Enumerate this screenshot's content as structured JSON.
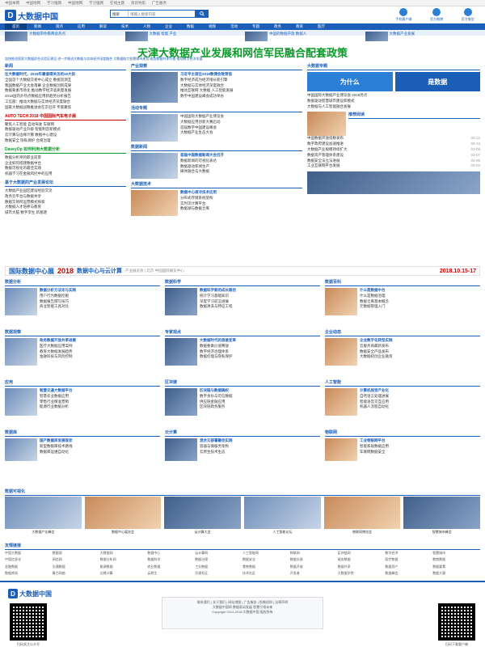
{
  "topbar": [
    "中国本网",
    "中国地网",
    "学习强网",
    "中国地网",
    "学习强网",
    "在线主题",
    "资讯导航",
    "广告服务"
  ],
  "logo": {
    "mark": "D",
    "text": "大数据中国"
  },
  "search": {
    "select": "搜索",
    "placeholder": "请输入搜索内容",
    "button_icon": "search-icon"
  },
  "apps": [
    "手机客户端",
    "官方微博",
    "官方微信"
  ],
  "nav": [
    "首页",
    "新闻",
    "观点",
    "应用",
    "解读",
    "技术",
    "人物",
    "企业",
    "数据",
    "视频",
    "活动",
    "专题",
    "政务",
    "教育",
    "医疗"
  ],
  "headlines": [
    "大数据带你看两会热点",
    "大数据 智能 产业",
    "中国的数据开放 数据人",
    "大数据产业发展"
  ],
  "main_title": "天津大数据产业发展和网信军民融合配套政策",
  "subline": "加快推进国家大数据综合试验区建设 进一步推进大数据与实体经济深度融合 大数据助力智慧城市建设 政务数据共享开放 推动数字经济发展",
  "left_news": {
    "title": "新闻",
    "items": [
      "在大数据时代，2018年最值得关注的15大技",
      "全国首个大数据交易中心成立 数据资源互",
      "我国数据产业大会落幕 企业数据创新成果",
      "数据要素市场化 推动数字经济高质量发展",
      "2018国内外热点数据应用新趋势分析报告",
      "工信部：推动大数据与实体经济深度融合",
      "国家大数据战略推进会在京召开 专家聚焦"
    ]
  },
  "left_red": {
    "title": "AUTO TECH 2018 中国国际汽车电子展",
    "items": [
      "聚焦人工智能 自动驾驶 车联网",
      "数据驱动产业升级 智能制造新模式",
      "云计算与边缘计算 数据中心建设",
      "数据安全 隐私保护 合规治理"
    ]
  },
  "left_green": {
    "title": "DaveyOp 如何利用大数据分析",
    "items": [
      "数据分析师的职业前景",
      "企业如何搭建数据中台",
      "数据可视化的最佳实践",
      "机器学习在金融风控中的应用"
    ]
  },
  "left_bottom": {
    "title": "基于大数据的产业发展论坛",
    "items": [
      "大数据产业园区建设经验交流",
      "政务云平台与数据共享",
      "数据交易所运营模式探索",
      "大数据人才培养与教育",
      "城市大脑 数字孪生 新基建"
    ]
  },
  "industry": {
    "title": "产业观察",
    "lead": "习近平主席在2018数博会致贺信",
    "items": [
      "数字经济成为经济增长新引擎",
      "大数据与实体经济深度融合",
      "推动互联网 大数据 人工智能发展",
      "数字中国建设峰会成功举办"
    ]
  },
  "activity": {
    "title": "活动专题",
    "items": [
      "中国国际大数据产业博览会",
      "大数据应用创新大赛启动",
      "首届数字中国建设峰会",
      "大数据产业生态大会"
    ]
  },
  "right_col": {
    "title": "大数据专题",
    "badges": [
      "为什么",
      "是数据"
    ],
    "items": [
      "中国国际大数据产业博览会 2018亮点",
      "数据驱动智慧城市建设新模式",
      "大数据与人工智能融合发展"
    ]
  },
  "right_list": {
    "title": "推荐阅读",
    "items": [
      {
        "text": "中国数据开放指数发布",
        "date": "03-13"
      },
      {
        "text": "数字政府建设加速推进",
        "date": "03-13"
      },
      {
        "text": "大数据产业规模持续扩大",
        "date": "03-08"
      },
      {
        "text": "数据资产管理体系建设",
        "date": "03-07"
      },
      {
        "text": "数据安全法立法进展",
        "date": "03-05"
      },
      {
        "text": "工业互联网平台发展",
        "date": "03-04"
      }
    ]
  },
  "mid_sections": [
    {
      "title": "数据新闻",
      "lead": "首届中国数据新闻大会召开",
      "items": [
        "数据新闻的可视化表达",
        "数据驱动新闻生产",
        "媒体融合与大数据"
      ]
    },
    {
      "title": "大数据技术",
      "lead": "数据中心液冷技术应用",
      "items": [
        "分布式存储系统架构",
        "实时流计算平台",
        "数据湖与数据仓库"
      ]
    }
  ],
  "banner": {
    "b1": "国际数据中心展",
    "b2": "2018",
    "b3": "数据中心与云计算",
    "b4": "产业展览会 | 北京·中国国际展览中心",
    "b5": "2018.10.15-17"
  },
  "sections_row1": [
    {
      "title": "数据分析",
      "items": [
        "数据分析方法论与实践",
        "用户行为数据挖掘",
        "数据报告撰写技巧",
        "商业智能工具对比"
      ]
    },
    {
      "title": "数据科学",
      "items": [
        "数据科学家的成长路径",
        "统计学习基础知识",
        "深度学习前沿进展",
        "数据清洗与特征工程"
      ]
    },
    {
      "title": "数据百科",
      "items": [
        "什么是数据中台",
        "什么是数据治理",
        "数据仓库基本概念",
        "元数据管理入门"
      ]
    }
  ],
  "sections_row2": [
    {
      "title": "数据观察",
      "items": [
        "政务数据开放共享进展",
        "医疗大数据应用案例",
        "教育大数据发展趋势",
        "金融科技与风险控制"
      ]
    },
    {
      "title": "专家观点",
      "items": [
        "大数据时代的思维变革",
        "数据要素价值释放",
        "数字经济治理体系",
        "数据伦理与隐私保护"
      ]
    },
    {
      "title": "企业动态",
      "items": [
        "企业数字化转型实践",
        "云服务商最新发布",
        "数据安全产品发布",
        "大数据初创企业融资"
      ]
    }
  ],
  "sections_row3": [
    {
      "title": "应用",
      "items": [
        "智慧交通大数据平台",
        "智慧农业数据应用",
        "零售行业精准营销",
        "能源行业数据分析"
      ]
    },
    {
      "title": "区块链",
      "items": [
        "区块链与数据确权",
        "数字身份与可信数据",
        "供应链金融应用",
        "区块链政务服务"
      ]
    },
    {
      "title": "人工智能",
      "items": [
        "计算机视觉产业化",
        "自然语言处理进展",
        "智能语音交互应用",
        "机器人流程自动化"
      ]
    }
  ],
  "sections_row4": [
    {
      "title": "数据库",
      "items": [
        "国产数据库发展现状",
        "新型数据库技术路线",
        "数据库运维自动化"
      ]
    },
    {
      "title": "云计算",
      "items": [
        "混合云部署最佳实践",
        "容器与微服务架构",
        "云原生技术生态"
      ]
    },
    {
      "title": "物联网",
      "items": [
        "工业物联网平台",
        "智能家居数据应用",
        "车联网数据安全"
      ]
    }
  ],
  "gallery": {
    "title": "数据可视化",
    "cards": [
      "大数据产业峰会",
      "数据中心展览会",
      "云计算大会",
      "人工智能论坛",
      "物联网博览会",
      "智慧城市峰会"
    ]
  },
  "friends": {
    "title": "友情链接",
    "links": [
      "中国大数据",
      "数据观",
      "大数据网",
      "数据中心",
      "云计算网",
      "人工智能网",
      "物联网",
      "区块链网",
      "数字经济",
      "智慧城市",
      "中国信息化",
      "网信网",
      "数据分析网",
      "数据科学",
      "数据治理",
      "数据安全",
      "数据交易",
      "政务数据",
      "医疗数据",
      "教育数据",
      "金融数据",
      "交通数据",
      "能源数据",
      "农业数据",
      "工业数据",
      "零售数据",
      "数据开放",
      "数据共享",
      "数据资产",
      "数据要素",
      "数据库网",
      "算力网络",
      "边缘计算",
      "云原生",
      "开源社区",
      "技术社区",
      "开发者",
      "大数据学院",
      "数据峰会",
      "数据大赛"
    ]
  },
  "footer": {
    "links": "联系我们 | 关于我们 | 网站地图 | 广告服务 | 投稿须知 | 法律声明",
    "line1": "Copyright 2014-2018 大数据中国 版权所有",
    "line2": "大数据中国网 数据驱动发展 智慧引领未来",
    "logo_text": "大数据中国",
    "qr_left": "扫码关注公众号",
    "qr_right": "扫码下载客户端"
  }
}
